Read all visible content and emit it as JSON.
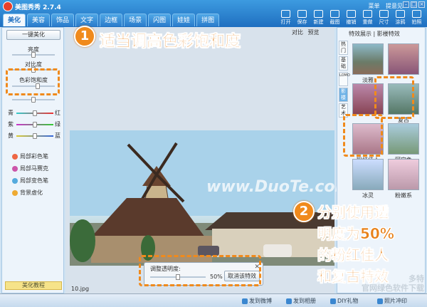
{
  "app": {
    "title": "美图秀秀 2.7.4",
    "menu": [
      "菜单",
      "提意见"
    ]
  },
  "tabs": [
    "美化",
    "美容",
    "饰品",
    "文字",
    "边框",
    "场景",
    "闪图",
    "娃娃",
    "拼图"
  ],
  "toolbar": [
    "打开",
    "保存",
    "新建",
    "截图",
    "撤销",
    "重做",
    "尺寸",
    "涂鸦",
    "拍照"
  ],
  "left_panel": {
    "auto_button": "一键美化",
    "sliders": [
      "亮度",
      "对比度",
      "色彩饱和度"
    ],
    "color_balance": [
      [
        "青",
        "红"
      ],
      [
        "紫",
        "绿"
      ],
      [
        "黄",
        "蓝"
      ]
    ],
    "tools": [
      "局部彩色笔",
      "局部马赛克",
      "局部变色笔",
      "背景虚化"
    ],
    "tutorial": "美化教程"
  },
  "canvas": {
    "compare": "对比",
    "compare2": "预览",
    "filename": "10.jpg",
    "watermark": "www.DuoTe.com",
    "opacity": {
      "label": "调整透明度:",
      "value": "50%",
      "cancel": "取消该特效"
    }
  },
  "right_panel": {
    "header": "特效展示 | 影楼特效",
    "categories": [
      "热门",
      "基础",
      "LOMO",
      "影楼",
      "艺术"
    ],
    "effects": [
      "淡雅",
      "",
      "",
      "复古",
      "粉红佳人",
      "阿宝色",
      "冰灵",
      "粉嫩系"
    ]
  },
  "status": [
    "发到微博",
    "发到相册",
    "DIY礼物",
    "照片冲印"
  ],
  "annotations": {
    "step1_num": "1",
    "step1": "适当调高色彩饱和度",
    "step2_num": "2",
    "step2_lines": [
      "分别使用透",
      "明度为50%",
      "的粉红佳人",
      "和复古特效"
    ],
    "site_watermark": [
      "多特",
      "官网绿色软件下载"
    ]
  },
  "colors": {
    "accent": "#f08a1c",
    "titlebar": "#2b7ccc"
  }
}
